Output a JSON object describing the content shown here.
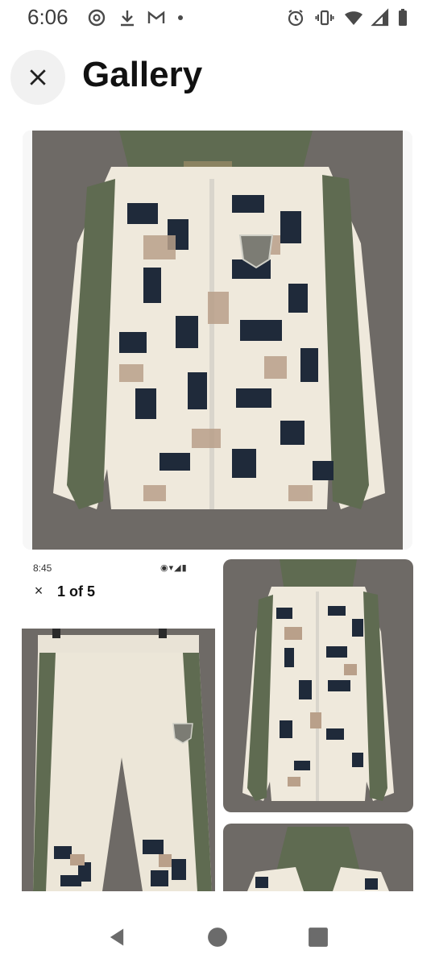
{
  "status_bar": {
    "time": "6:06",
    "left_icons": [
      "threads-icon",
      "download-icon",
      "gmail-icon",
      "dot-icon"
    ],
    "right_icons": [
      "alarm-icon",
      "vibrate-icon",
      "wifi-icon",
      "signal-icon",
      "battery-icon"
    ]
  },
  "app_bar": {
    "title": "Gallery",
    "close_icon": "close-icon"
  },
  "gallery": {
    "images": [
      {
        "description_name": "jacket-photo-main"
      },
      {
        "description_name": "screenshot-pants-photo"
      },
      {
        "description_name": "jacket-photo-thumbnail"
      },
      {
        "description_name": "jacket-hood-photo-thumbnail"
      }
    ],
    "inner_screenshot": {
      "time": "8:45",
      "counter": "1 of 5"
    }
  },
  "nav_bar": {
    "icons": [
      "back-icon",
      "home-icon",
      "recents-icon"
    ]
  },
  "colors": {
    "olive": "#5f6b51",
    "cream": "#efe9dc",
    "navy": "#1f2a3a",
    "tan": "#b9a08a",
    "wall": "#6e6a66"
  }
}
